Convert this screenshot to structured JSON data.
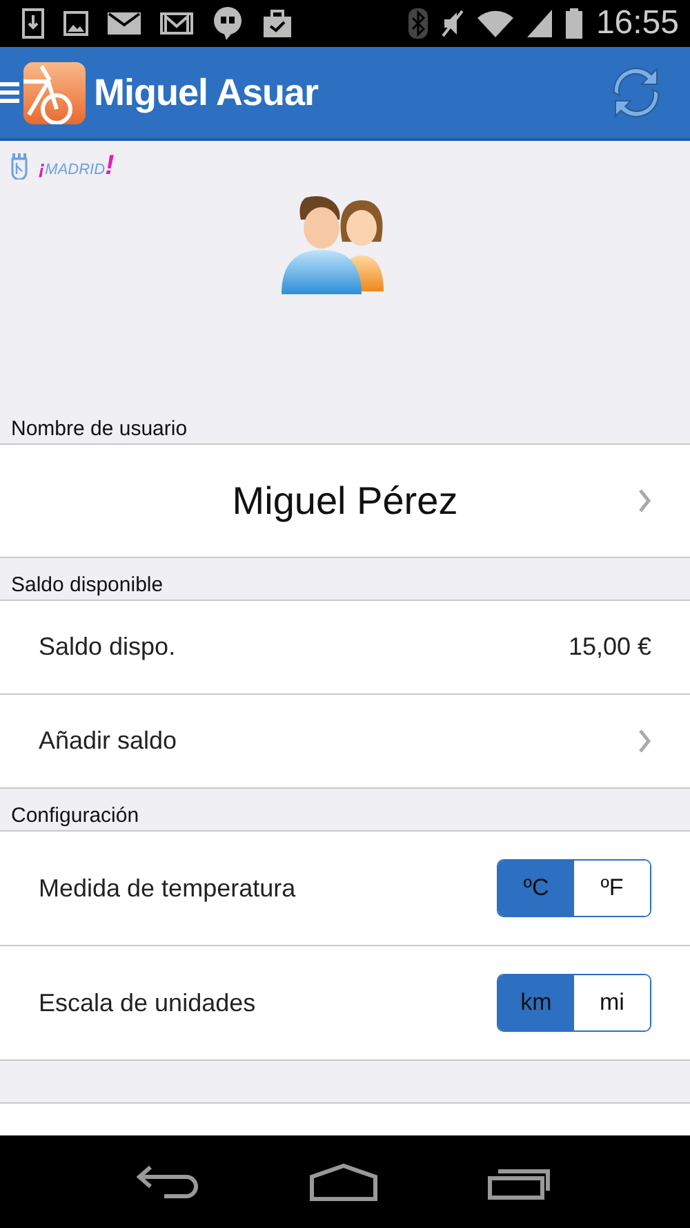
{
  "status_bar": {
    "time": "16:55"
  },
  "app_bar": {
    "title": "Miguel Asuar"
  },
  "brand": {
    "label": "MADRID",
    "prefix": "¡",
    "suffix": "!"
  },
  "sections": [
    {
      "label": "Nombre de usuario",
      "rows": [
        {
          "kind": "name",
          "text": "Miguel Pérez",
          "chevron": true
        }
      ]
    },
    {
      "label": "Saldo disponible",
      "rows": [
        {
          "kind": "value",
          "text": "Saldo dispo.",
          "value": "15,00 €"
        },
        {
          "kind": "link",
          "text": "Añadir saldo",
          "chevron": true
        }
      ]
    },
    {
      "label": "Configuración",
      "rows": [
        {
          "kind": "toggle",
          "text": "Medida de temperatura",
          "options": [
            {
              "label": "ºC",
              "selected": true
            },
            {
              "label": "ºF",
              "selected": false
            }
          ]
        },
        {
          "kind": "toggle",
          "text": "Escala de unidades",
          "options": [
            {
              "label": "km",
              "selected": true
            },
            {
              "label": "mi",
              "selected": false
            }
          ]
        }
      ]
    }
  ]
}
